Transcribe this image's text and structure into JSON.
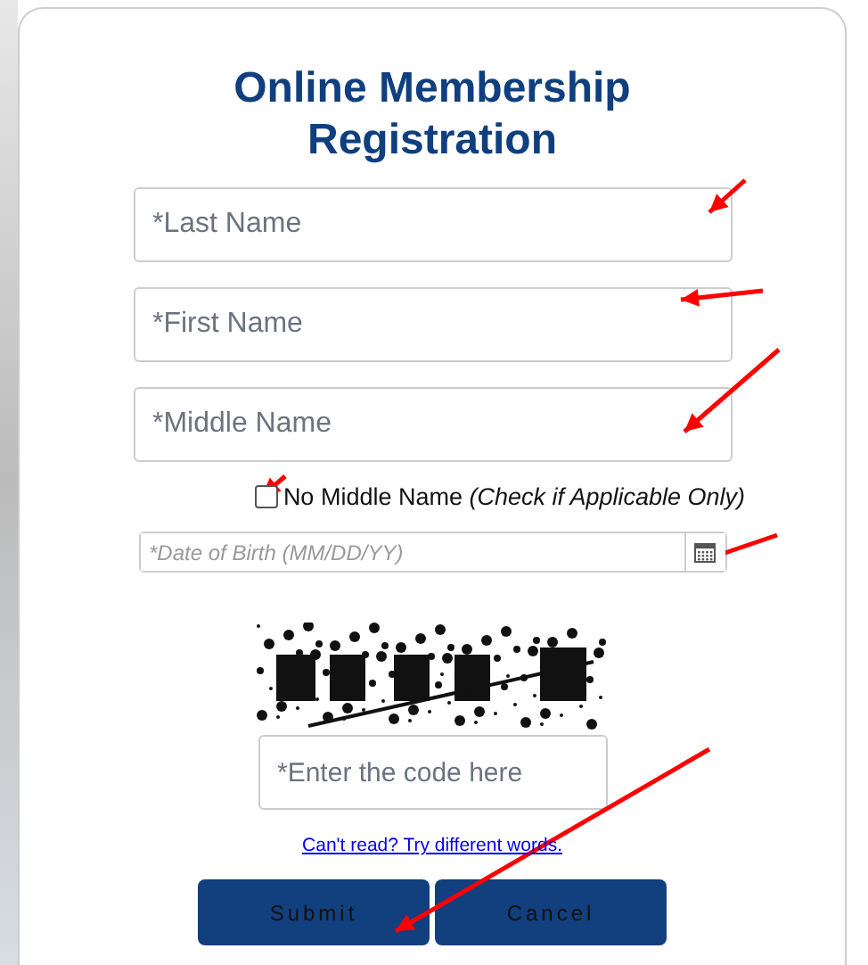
{
  "title": "Online Membership Registration",
  "name_fields": [
    {
      "placeholder": "*Last Name"
    },
    {
      "placeholder": "*First Name"
    },
    {
      "placeholder": "*Middle Name"
    }
  ],
  "no_middle_name": {
    "label": "No Middle Name",
    "note": "(Check if Applicable Only)",
    "checked": false
  },
  "date_of_birth": {
    "placeholder": "*Date of Birth (MM/DD/YY)"
  },
  "code_field": {
    "placeholder": "*Enter the code here"
  },
  "refresh_link": "Can't read? Try different words.",
  "buttons": [
    {
      "label": "Submit"
    },
    {
      "label": "Cancel"
    }
  ]
}
